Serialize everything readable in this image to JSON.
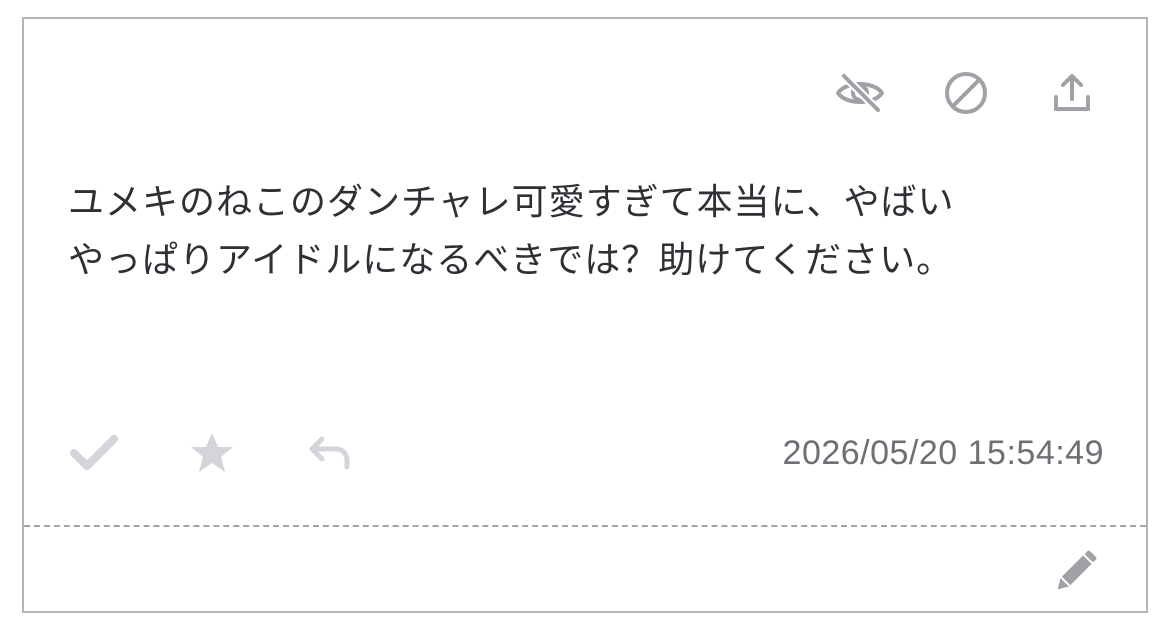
{
  "message": {
    "lines": [
      "ユメキのねこのダンチャレ可愛すぎて本当に、やばい",
      "やっぱりアイドルになるべきでは？助けてください。"
    ]
  },
  "timestamp": "2026/05/20 15:54:49",
  "icons": {
    "hide": "eye-off-icon",
    "block": "block-icon",
    "share": "share-icon",
    "check": "check-icon",
    "star": "star-icon",
    "reply": "reply-icon",
    "edit": "pencil-icon"
  },
  "colors": {
    "icon_dark": "#a0a0a6",
    "icon_light": "#d4d4da",
    "text": "#2f2f35",
    "timestamp": "#6e6e74",
    "border": "#b4b4b8"
  }
}
